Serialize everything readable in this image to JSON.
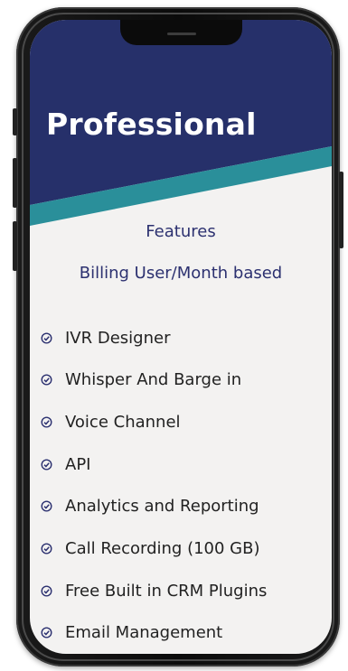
{
  "plan": {
    "title": "Professional",
    "features_heading": "Features",
    "billing_note": "Billing User/Month based"
  },
  "features": [
    "IVR Designer",
    "Whisper And Barge in",
    "Voice Channel",
    "API",
    "Analytics and Reporting",
    "Call Recording (100 GB)",
    "Free Built in CRM Plugins",
    "Email Management"
  ],
  "colors": {
    "header_navy": "#26306a",
    "accent_teal": "#2a8f9a",
    "screen_bg": "#f3f2f1",
    "heading_text": "#2c3170",
    "check_icon": "#2c3170"
  },
  "icons": {
    "feature_bullet": "check-circle-icon"
  }
}
